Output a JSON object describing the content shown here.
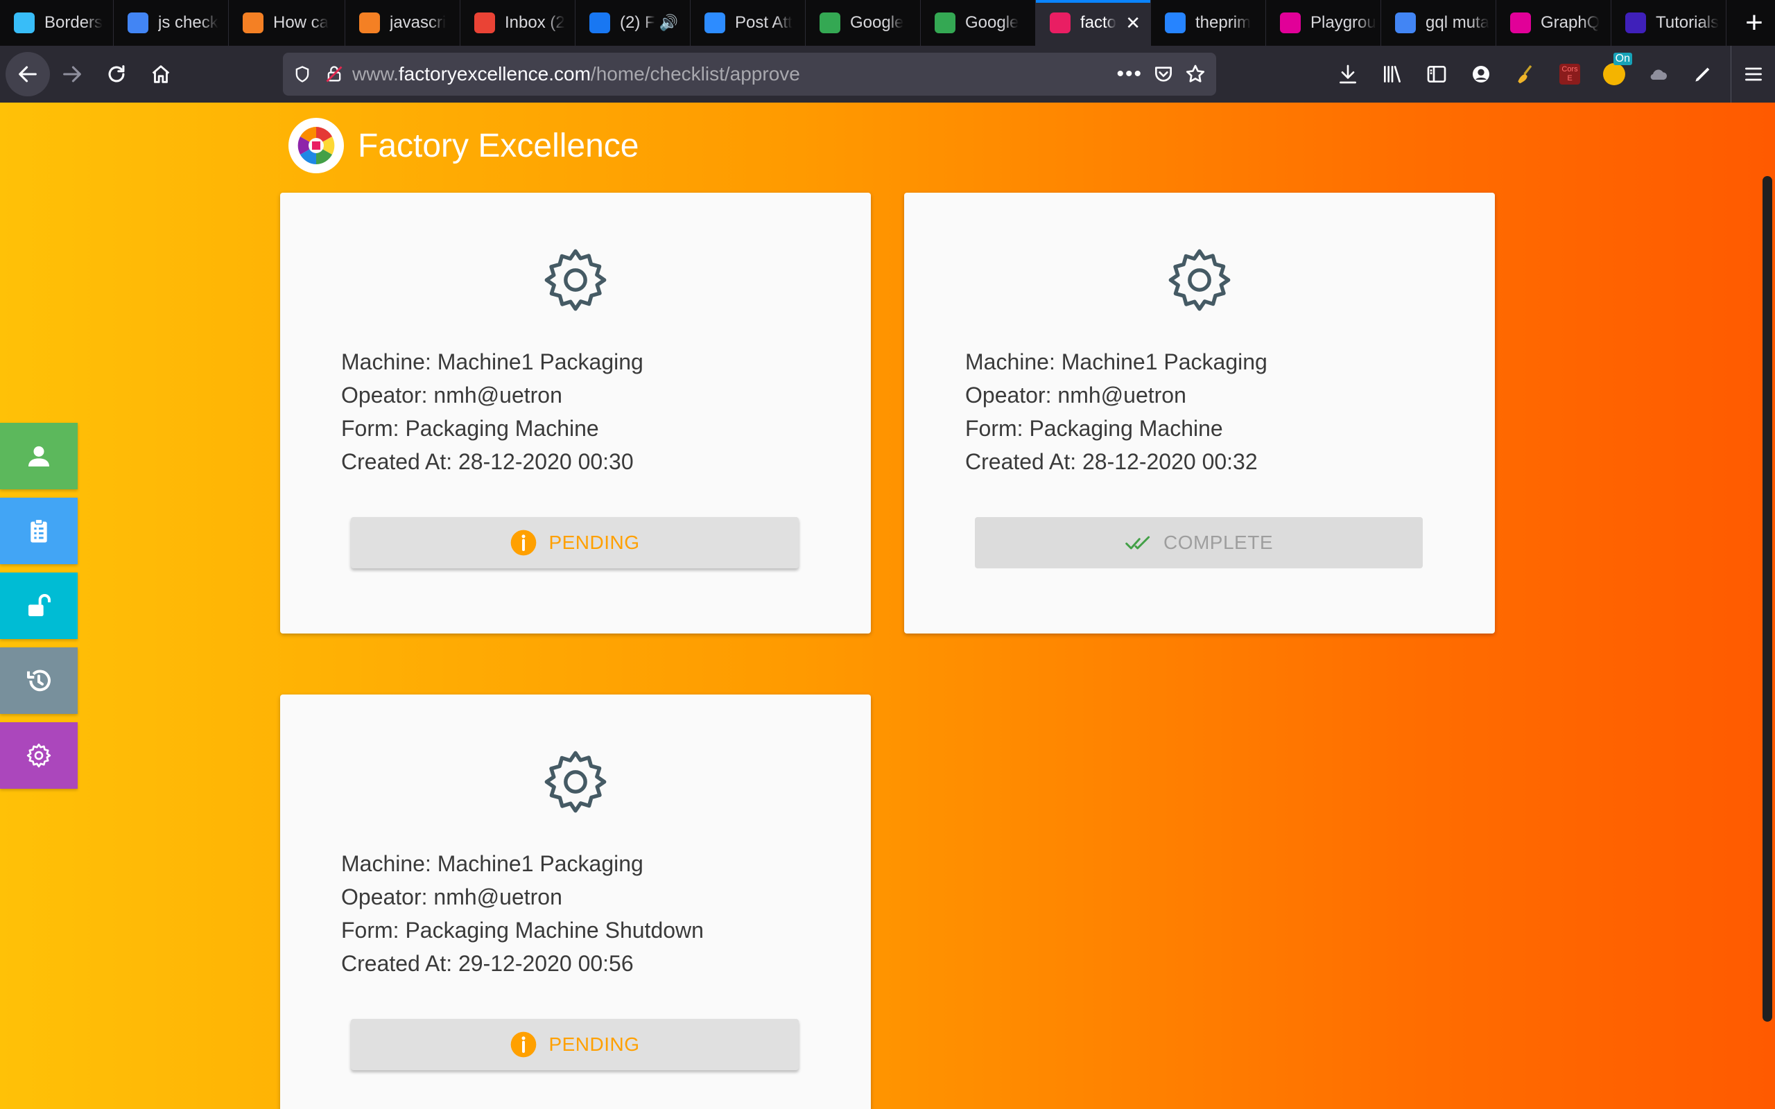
{
  "browser": {
    "tabs": [
      {
        "label": "Borders",
        "icon": "tailwind-icon",
        "color": "#38bdf8",
        "active": false
      },
      {
        "label": "js check",
        "icon": "google-icon",
        "color": "#4285f4",
        "active": false
      },
      {
        "label": "How ca",
        "icon": "stackoverflow-icon",
        "color": "#f48024",
        "active": false
      },
      {
        "label": "javascri",
        "icon": "stackoverflow-icon",
        "color": "#f48024",
        "active": false
      },
      {
        "label": "Inbox (2",
        "icon": "gmail-icon",
        "color": "#ea4335",
        "active": false
      },
      {
        "label": "(2) F",
        "icon": "facebook-icon",
        "color": "#1877f2",
        "active": false,
        "audio": true
      },
      {
        "label": "Post Att",
        "icon": "zoom-icon",
        "color": "#2d8cff",
        "active": false
      },
      {
        "label": "Google",
        "icon": "chrome-icon",
        "color": "#34a853",
        "active": false
      },
      {
        "label": "Google",
        "icon": "chrome-icon",
        "color": "#34a853",
        "active": false
      },
      {
        "label": "facto",
        "icon": "factory-icon",
        "color": "#e91e63",
        "active": true
      },
      {
        "label": "theprim",
        "icon": "bitbucket-icon",
        "color": "#2684ff",
        "active": false
      },
      {
        "label": "Playgrou",
        "icon": "graphql-playground-icon",
        "color": "#e10098",
        "active": false
      },
      {
        "label": "gql muta",
        "icon": "google-icon",
        "color": "#4285f4",
        "active": false
      },
      {
        "label": "GraphQ",
        "icon": "graphql-icon",
        "color": "#e10098",
        "active": false
      },
      {
        "label": "Tutorials",
        "icon": "apollo-icon",
        "color": "#3f20ba",
        "active": false
      }
    ],
    "url_prefix": "www.",
    "url_host": "factoryexcellence.com",
    "url_path": "/home/checklist/approve",
    "extension_badge": "On"
  },
  "app": {
    "title": "Factory Excellence",
    "sidebar": [
      {
        "name": "profile",
        "icon": "user-icon",
        "color": "#5cb85c"
      },
      {
        "name": "checklist",
        "icon": "clipboard-icon",
        "color": "#42a5f5"
      },
      {
        "name": "approve",
        "icon": "unlock-icon",
        "color": "#00bcd4"
      },
      {
        "name": "history",
        "icon": "history-icon",
        "color": "#78909c"
      },
      {
        "name": "settings",
        "icon": "gear-icon",
        "color": "#ab47bc"
      }
    ],
    "cards": [
      {
        "machine": "Machine: Machine1 Packaging",
        "operator": "Opeator: nmh@uetron",
        "form": "Form: Packaging Machine",
        "created": "Created At: 28-12-2020 00:30",
        "status": "PENDING",
        "status_type": "pending"
      },
      {
        "machine": "Machine: Machine1 Packaging",
        "operator": "Opeator: nmh@uetron",
        "form": "Form: Packaging Machine",
        "created": "Created At: 28-12-2020 00:32",
        "status": "COMPLETE",
        "status_type": "complete"
      },
      {
        "machine": "Machine: Machine1 Packaging",
        "operator": "Opeator: nmh@uetron",
        "form": "Form: Packaging Machine Shutdown",
        "created": "Created At: 29-12-2020 00:56",
        "status": "PENDING",
        "status_type": "pending"
      }
    ]
  }
}
